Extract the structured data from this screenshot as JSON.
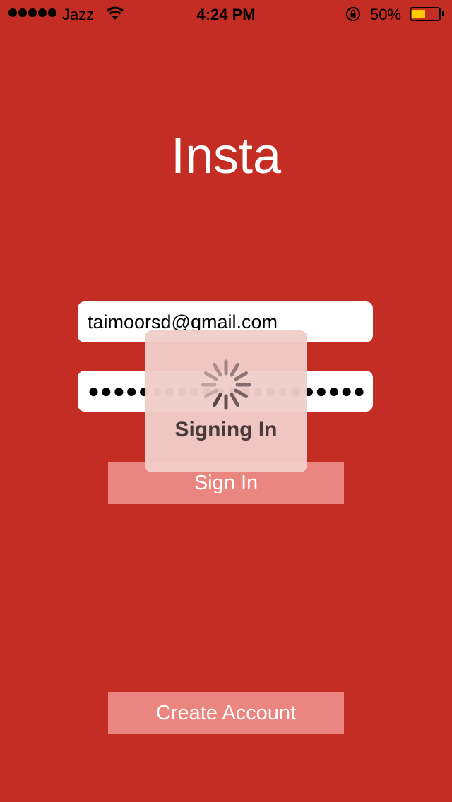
{
  "status_bar": {
    "carrier": "Jazz",
    "time": "4:24 PM",
    "battery_percent": "50%",
    "battery_level": 0.5,
    "signal_bars": 5,
    "icons": [
      "signal-dots-icon",
      "wifi-icon",
      "rotation-lock-icon",
      "battery-icon"
    ]
  },
  "app": {
    "title": "Insta"
  },
  "login": {
    "email_value": "taimoorsd@gmail.com",
    "password_value": "●●●●●●●●●●●●●●●●●●●●●●"
  },
  "buttons": {
    "sign_in_label": "Sign In",
    "create_account_label": "Create Account"
  },
  "hud": {
    "label": "Signing In",
    "icon": "spinner-icon"
  },
  "colors": {
    "background": "#C42D23",
    "button": "#EB8580",
    "battery_fill": "#FFCC00"
  }
}
